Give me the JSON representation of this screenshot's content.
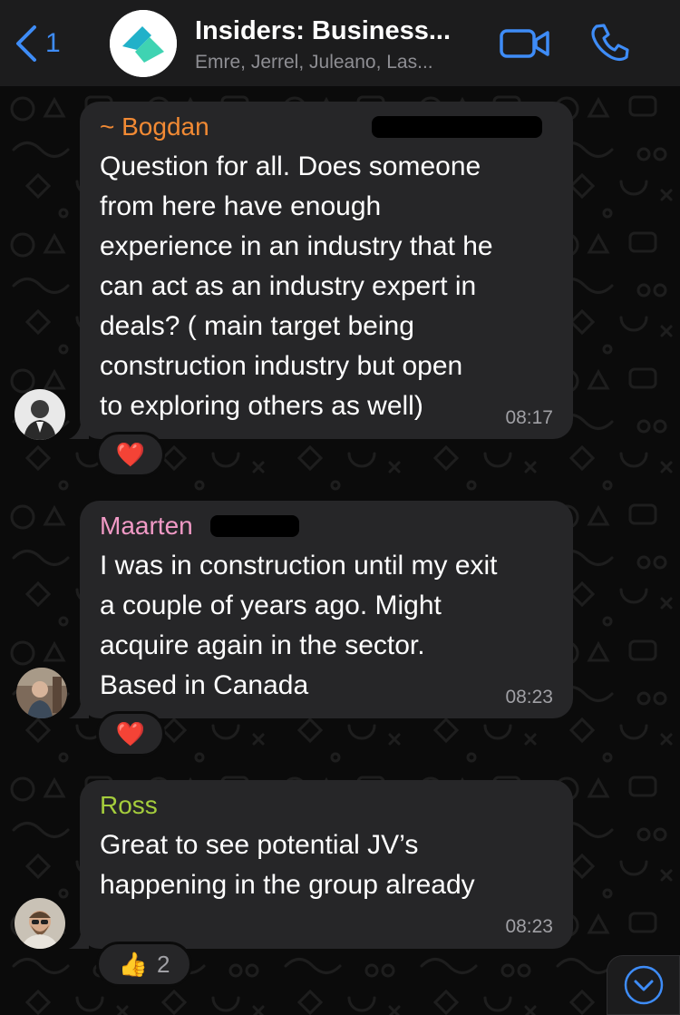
{
  "header": {
    "back_count": "1",
    "title": "Insiders: Business...",
    "subtitle": "Emre, Jerrel, Juleano, Las...",
    "icons": {
      "back": "chevron-left-icon",
      "video": "video-call-icon",
      "phone": "phone-call-icon"
    }
  },
  "messages": [
    {
      "sender": "~ Bogdan",
      "sender_color": "#f28a34",
      "lines": [
        "Question for all. Does someone",
        "from here have enough",
        "experience in an industry that he",
        "can act as an industry expert  in",
        "deals? ( main target being",
        "construction industry but open",
        "to exploring others as well)"
      ],
      "time": "08:17",
      "reaction": {
        "emoji": "❤️",
        "count": ""
      }
    },
    {
      "sender": "Maarten",
      "sender_color": "#f19ac6",
      "lines": [
        "I was in construction until my exit",
        "a couple of years ago. Might",
        "acquire again in the sector.",
        "Based in Canada"
      ],
      "time": "08:23",
      "reaction": {
        "emoji": "❤️",
        "count": ""
      }
    },
    {
      "sender": "Ross",
      "sender_color": "#a5cd3c",
      "lines": [
        "Great to see potential JV’s",
        "happening in the group already"
      ],
      "time": "08:23",
      "reaction": {
        "emoji": "👍",
        "count": "2"
      }
    }
  ],
  "colors": {
    "accent": "#3e8cf7",
    "bubble": "#262628",
    "header": "#1c1c1d",
    "background": "#0b0b0b"
  }
}
